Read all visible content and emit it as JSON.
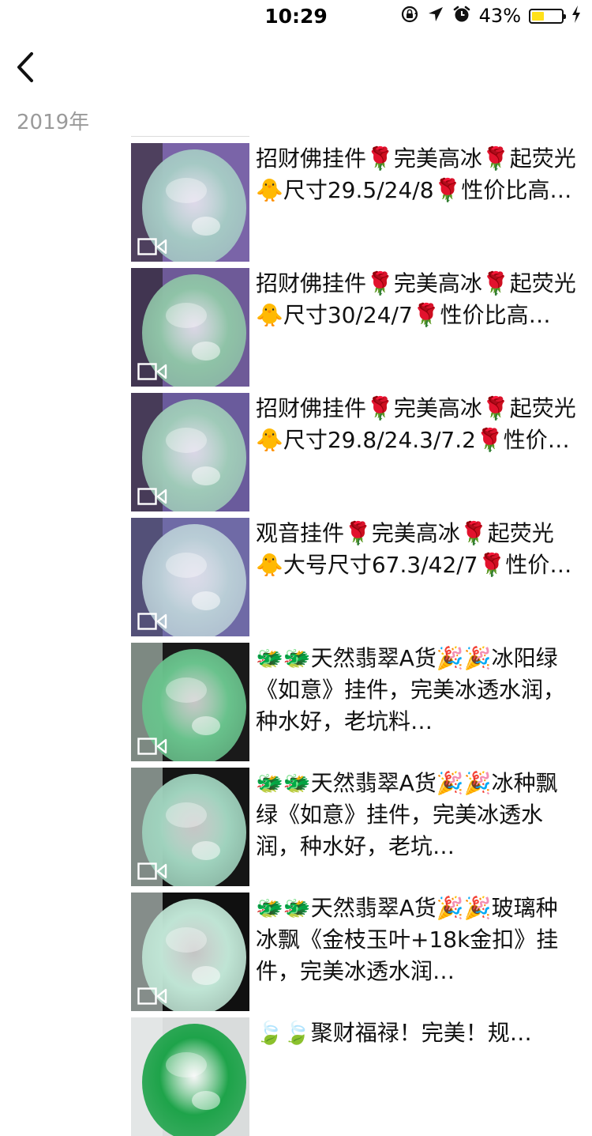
{
  "status_bar": {
    "time": "10:29",
    "battery_percent": "43%",
    "battery_level": 0.43,
    "icons": [
      "rotation-lock-icon",
      "location-arrow-icon",
      "alarm-clock-icon",
      "battery-icon",
      "charging-bolt-icon"
    ]
  },
  "nav": {
    "back_icon": "chevron-left-icon"
  },
  "section": {
    "year": "2019年"
  },
  "posts": [
    {
      "text": "招财佛挂件🌹完美高冰🌹起荧光🐥尺寸29.5/24/8🌹性价比高…",
      "has_video": true,
      "thumb_colors": [
        "#7a64a8",
        "#a5c9c4",
        "#2a2320"
      ]
    },
    {
      "text": "招财佛挂件🌹完美高冰🌹起荧光🐥尺寸30/24/7🌹性价比高…",
      "has_video": true,
      "thumb_colors": [
        "#6e5a98",
        "#8fc3a7",
        "#1d1818"
      ]
    },
    {
      "text": "招财佛挂件🌹完美高冰🌹起荧光🐥尺寸29.8/24.3/7.2🌹性价…",
      "has_video": true,
      "thumb_colors": [
        "#6a5b9c",
        "#9fcab8",
        "#2a2020"
      ]
    },
    {
      "text": "观音挂件🌹完美高冰🌹起荧光🐥大号尺寸67.3/42/7🌹性价…",
      "has_video": true,
      "thumb_colors": [
        "#6f6aa6",
        "#b9cdd6",
        "#3d3a52"
      ]
    },
    {
      "text": "🐲🐲天然翡翠A货🎉🎉冰阳绿《如意》挂件，完美冰透水润，种水好，老坑料…",
      "has_video": true,
      "thumb_colors": [
        "#1a1a1a",
        "#69c28c",
        "#d0e6d8"
      ]
    },
    {
      "text": "🐲🐲天然翡翠A货🎉🎉冰种飘绿《如意》挂件，完美冰透水润，种水好，老坑…",
      "has_video": true,
      "thumb_colors": [
        "#151515",
        "#9fd2bd",
        "#d9ece4"
      ]
    },
    {
      "text": "🐲🐲天然翡翠A货🎉🎉玻璃种冰飘《金枝玉叶+18k金扣》挂件，完美冰透水润…",
      "has_video": true,
      "thumb_colors": [
        "#101010",
        "#bfe4d4",
        "#e6f4ee"
      ]
    },
    {
      "text": "🍃🍃聚财福禄！完美！规…",
      "has_video": false,
      "thumb_colors": [
        "#d9dcdc",
        "#1ea34a",
        "#ebeeee"
      ]
    }
  ]
}
